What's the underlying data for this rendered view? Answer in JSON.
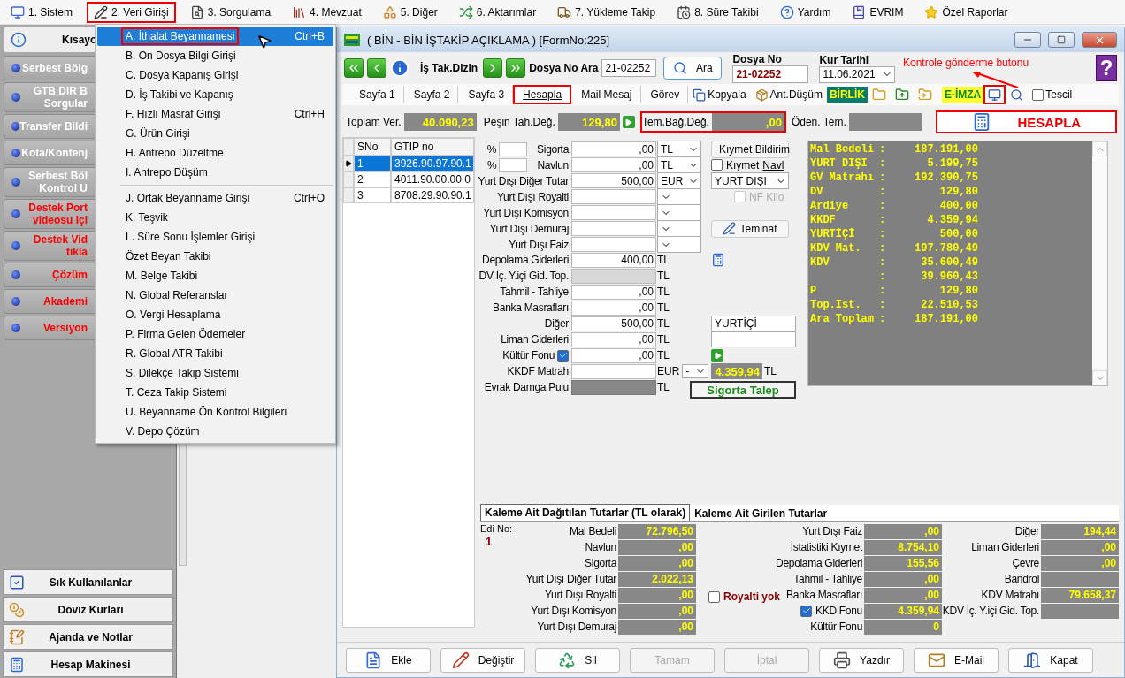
{
  "menubar": [
    {
      "label": "1. Sistem",
      "highlighted": false
    },
    {
      "label": "2. Veri Girişi",
      "highlighted": true
    },
    {
      "label": "3. Sorgulama",
      "highlighted": false
    },
    {
      "label": "4. Mevzuat",
      "highlighted": false
    },
    {
      "label": "5. Diğer",
      "highlighted": false
    },
    {
      "label": "6. Aktarımlar",
      "highlighted": false
    },
    {
      "label": "7. Yükleme Takip",
      "highlighted": false
    },
    {
      "label": "8. Süre Takibi",
      "highlighted": false
    },
    {
      "label": "Yardım",
      "highlighted": false
    },
    {
      "label": "EVRIM",
      "highlighted": false
    },
    {
      "label": "Özel Raporlar",
      "highlighted": false
    }
  ],
  "dropdown": {
    "groups": [
      {
        "items": [
          {
            "label": "A. İthalat Beyannamesi",
            "shortcut": "Ctrl+B",
            "selected": true,
            "highlighted": true
          },
          {
            "label": "B. Ön Dosya Bilgi Girişi",
            "selected": false,
            "highlighted": false
          },
          {
            "label": "C. Dosya Kapanış Girişi",
            "selected": false,
            "highlighted": false
          },
          {
            "label": "D. İş Takibi ve Kapanış",
            "selected": false,
            "highlighted": false
          },
          {
            "label": "F. Hızlı Masraf Girişi",
            "shortcut": "Ctrl+H",
            "selected": false,
            "highlighted": false
          },
          {
            "label": "G. Ürün Girişi",
            "selected": false,
            "highlighted": false
          },
          {
            "label": "H. Antrepo Düzeltme",
            "selected": false,
            "highlighted": false
          },
          {
            "label": "I. Antrepo Düşüm",
            "selected": false,
            "highlighted": false
          }
        ]
      },
      {
        "items": [
          {
            "label": "J. Ortak Beyanname Girişi",
            "shortcut": "Ctrl+O",
            "selected": false,
            "highlighted": false
          },
          {
            "label": "K. Teşvik",
            "selected": false,
            "highlighted": false
          },
          {
            "label": "L. Süre Sonu İşlemler Girişi",
            "selected": false,
            "highlighted": false
          },
          {
            "label": "Özet Beyan Takibi",
            "selected": false,
            "highlighted": false
          },
          {
            "label": "M. Belge Takibi",
            "selected": false,
            "highlighted": false
          },
          {
            "label": "N. Global Referanslar",
            "selected": false,
            "highlighted": false
          },
          {
            "label": "O. Vergi Hesaplama",
            "selected": false,
            "highlighted": false
          },
          {
            "label": "P. Firma Gelen Ödemeler",
            "selected": false,
            "highlighted": false
          },
          {
            "label": "R. Global ATR Takibi",
            "selected": false,
            "highlighted": false
          },
          {
            "label": "S. Dilekçe Takip Sistemi",
            "selected": false,
            "highlighted": false
          },
          {
            "label": "T. Ceza Takip Sistemi",
            "selected": false,
            "highlighted": false
          },
          {
            "label": "U. Beyanname Ön Kontrol Bilgileri",
            "selected": false,
            "highlighted": false
          },
          {
            "label": "V. Depo Çözüm",
            "selected": false,
            "highlighted": false
          }
        ]
      }
    ]
  },
  "sidebar": {
    "header": "Kısayo",
    "items": [
      {
        "lines": [
          "Serbest Bölg"
        ],
        "kind": "normal"
      },
      {
        "lines": [
          "GTB DIR B",
          "Sorgular"
        ],
        "kind": "normal"
      },
      {
        "lines": [
          "Transfer Bildi"
        ],
        "kind": "normal"
      },
      {
        "lines": [
          "Kota/Kontenj"
        ],
        "kind": "normal"
      },
      {
        "lines": [
          "Serbest Böl",
          "Kontrol U"
        ],
        "kind": "normal"
      },
      {
        "lines": [
          "Destek Port",
          "videosu içi"
        ],
        "kind": "support"
      },
      {
        "lines": [
          "Destek Vid",
          "tıkla"
        ],
        "kind": "support"
      },
      {
        "lines": [
          "Çözüm"
        ],
        "kind": "support"
      },
      {
        "lines": [
          "Akademi"
        ],
        "kind": "support"
      },
      {
        "lines": [
          "Versiyon"
        ],
        "kind": "support"
      }
    ],
    "bottom": [
      "Sık Kullanılanlar",
      "Doviz Kurları",
      "Ajanda ve Notlar",
      "Hesap Makinesi"
    ]
  },
  "window": {
    "title": "( BİN - BİN İŞTAKİP AÇIKLAMA ) [FormNo:225]"
  },
  "toolbar": {
    "dizin_label": "İş Tak.Dizin",
    "search_label": "Dosya No Ara",
    "search_value": "21-02252",
    "search_button": "Ara",
    "dosya_no_label": "Dosya No",
    "dosya_no": "21-02252",
    "kur_label": "Kur Tarihi",
    "kur_value": "11.06.2021",
    "help_glyph": "?",
    "annotation": "Kontrole gönderme butonu"
  },
  "tabs": [
    {
      "label": "Sayfa 1",
      "selected": false,
      "highlighted": false
    },
    {
      "label": "Sayfa 2",
      "selected": false,
      "highlighted": false
    },
    {
      "label": "Sayfa 3",
      "selected": false,
      "highlighted": false
    },
    {
      "label": "Hesapla",
      "selected": true,
      "highlighted": true
    },
    {
      "label": "Mail Mesaj",
      "selected": false,
      "highlighted": false
    },
    {
      "label": "Görev",
      "selected": false,
      "highlighted": false
    }
  ],
  "tools": [
    {
      "kind": "copy",
      "label": "Kopyala"
    },
    {
      "kind": "box",
      "label": "Ant.Düşüm"
    },
    {
      "kind": "badge",
      "label": "BİRLİK"
    },
    {
      "kind": "folder"
    },
    {
      "kind": "upload"
    },
    {
      "kind": "forward"
    },
    {
      "kind": "esign",
      "label": "E-İMZA"
    },
    {
      "kind": "monitor",
      "highlighted": true
    },
    {
      "kind": "search"
    },
    {
      "kind": "checkbox",
      "label": "Tescil",
      "checked": false
    }
  ],
  "totals": [
    {
      "label": "Toplam Ver.",
      "value": "40.090,23",
      "highlighted": false
    },
    {
      "label": "Peşin Tah.Değ.",
      "value": "129,80",
      "highlighted": false
    },
    {
      "label": "Tem.Bağ.Değ.",
      "value": ",00",
      "highlighted": true
    },
    {
      "label": "Öden. Tem.",
      "highlighted": false
    }
  ],
  "hesapla_button": "HESAPLA",
  "grid": {
    "columns": [
      "SNo",
      "GTIP no"
    ],
    "rows": [
      {
        "cells": [
          "1",
          "3926.90.97.90.1"
        ],
        "selected": true
      },
      {
        "cells": [
          "2",
          "4011.90.00.00.0"
        ],
        "selected": false
      },
      {
        "cells": [
          "3",
          "8708.29.90.90.1"
        ],
        "selected": false
      }
    ]
  },
  "form": [
    {
      "kind": "percent",
      "prefix": "%",
      "label": "Sigorta",
      "value": ",00",
      "currency": "TL",
      "side": {
        "kind": "report_button",
        "label": "Kıymet Bildirim"
      }
    },
    {
      "kind": "percent",
      "prefix": "%",
      "label": "Navlun",
      "value": ",00",
      "currency": "TL",
      "side": {
        "kind": "check_link",
        "label": "Kıymet",
        "link": "Navl",
        "checked": false
      }
    },
    {
      "kind": "select",
      "label": "Yurt Dışı Diğer Tutar",
      "value": "500,00",
      "currency": "EUR",
      "side": {
        "kind": "select",
        "value": "YURT DIŞI"
      }
    },
    {
      "kind": "select",
      "label": "Yurt Dışı Royalti",
      "side": {
        "kind": "disabled_check",
        "label": "NF Kilo",
        "checked": false
      }
    },
    {
      "kind": "select",
      "label": "Yurt Dışı Komisyon"
    },
    {
      "kind": "select",
      "label": "Yurt Dışı Demuraj",
      "side": {
        "kind": "sign_button",
        "label": "Teminat"
      }
    },
    {
      "kind": "select",
      "label": "Yurt Dışı Faiz"
    },
    {
      "kind": "plain",
      "label": "Depolama Giderleri",
      "value": "400,00",
      "currency": "TL",
      "side": {
        "kind": "calculator"
      }
    },
    {
      "kind": "gray",
      "label": "DV İç. Y.içi Gid. Top.",
      "currency": "TL"
    },
    {
      "kind": "plain",
      "label": "Tahmil - Tahliye",
      "value": ",00",
      "currency": "TL"
    },
    {
      "kind": "plain",
      "label": "Banka Masrafları",
      "value": ",00",
      "currency": "TL"
    },
    {
      "kind": "plain",
      "label": "Diğer",
      "value": "500,00",
      "currency": "TL",
      "side": {
        "kind": "field",
        "value": "YURTİÇİ"
      }
    },
    {
      "kind": "plain",
      "label": "Liman Giderleri",
      "value": ",00",
      "currency": "TL",
      "side": {
        "kind": "field"
      }
    },
    {
      "kind": "check",
      "label": "Kültür Fonu",
      "checked": true,
      "value": ",00",
      "currency": "TL",
      "side": {
        "kind": "go"
      }
    },
    {
      "kind": "kkdf",
      "label": "KKDF Matrah",
      "currency": "EUR",
      "option": "-",
      "side": {
        "kind": "result",
        "value": "4.359,94",
        "unit": "TL"
      }
    },
    {
      "kind": "gray",
      "label": "Evrak Damga Pulu",
      "currency": "TL",
      "side": {
        "kind": "talep_button",
        "label": "Sigorta Talep"
      }
    }
  ],
  "summary": [
    {
      "label": "Mal Bedeli",
      "colon": ":",
      "value": "187.191,00"
    },
    {
      "label": "YURT DIŞI",
      "colon": ":",
      "value": "5.199,75"
    },
    {
      "label": "GV Matrahı",
      "colon": ":",
      "value": "192.390,75"
    },
    {
      "label": "DV",
      "colon": ":",
      "value": "129,80"
    },
    {
      "label": "Ardiye",
      "colon": ":",
      "value": "400,00"
    },
    {
      "label": "KKDF",
      "colon": ":",
      "value": "4.359,94"
    },
    {
      "label": "YURTİÇİ",
      "colon": ":",
      "value": "500,00"
    },
    {
      "label": "KDV Mat.",
      "colon": ":",
      "value": "197.780,49"
    },
    {
      "label": "KDV",
      "colon": ":",
      "value": "35.600,49"
    },
    {
      "colon": ":",
      "value": "39.960,43"
    },
    {
      "label": "P",
      "colon": ":",
      "value": "129,80"
    },
    {
      "label": "Top.Ist.",
      "colon": ":",
      "value": "22.510,53"
    },
    {
      "label": "Ara Toplam",
      "colon": ":",
      "value": "187.191,00"
    }
  ],
  "bottom_tabs": [
    {
      "label": "Kaleme Ait Dağıtılan Tutarlar (TL olarak)",
      "selected": true
    },
    {
      "label": "Kaleme Ait Girilen Tutarlar",
      "selected": false
    }
  ],
  "bottom": {
    "edi_label": "Edi No:",
    "edi_value": "1",
    "royalti": {
      "label": "Royalti yok",
      "checked": false
    },
    "columns": [
      {
        "rows": [
          {
            "kind": "plain",
            "label": "Mal Bedeli",
            "value": "72.796,50"
          },
          {
            "kind": "plain",
            "label": "Navlun",
            "value": ",00"
          },
          {
            "kind": "plain",
            "label": "Sigorta",
            "value": ",00"
          },
          {
            "kind": "plain",
            "label": "Yurt Dışı Diğer Tutar",
            "value": "2.022,13"
          },
          {
            "kind": "plain",
            "label": "Yurt Dışı Royalti",
            "value": ",00"
          },
          {
            "kind": "plain",
            "label": "Yurt Dışı Komisyon",
            "value": ",00"
          },
          {
            "kind": "plain",
            "label": "Yurt Dışı Demuraj",
            "value": ",00"
          }
        ]
      },
      {
        "rows": [
          {
            "kind": "plain",
            "label": "Yurt Dışı Faiz",
            "value": ",00"
          },
          {
            "kind": "plain",
            "label": "İstatistiki Kıymet",
            "value": "8.754,10"
          },
          {
            "kind": "plain",
            "label": "Depolama Giderleri",
            "value": "155,56"
          },
          {
            "kind": "plain",
            "label": "Tahmil - Tahliye",
            "value": ",00"
          },
          {
            "kind": "plain",
            "label": "Banka Masrafları",
            "value": ",00"
          },
          {
            "kind": "check",
            "label": "KKD Fonu",
            "checked": true,
            "value": "4.359,94"
          },
          {
            "kind": "plain",
            "label": "Kültür Fonu",
            "value": "0"
          }
        ]
      },
      {
        "rows": [
          {
            "kind": "plain",
            "label": "Diğer",
            "value": "194,44"
          },
          {
            "kind": "plain",
            "label": "Liman Giderleri",
            "value": ",00"
          },
          {
            "kind": "plain",
            "label": "Çevre",
            "value": ",00"
          },
          {
            "kind": "plain",
            "label": "Bandrol"
          },
          {
            "kind": "plain",
            "label": "KDV Matrahı",
            "value": "79.658,37"
          },
          {
            "kind": "plain",
            "label": "KDV İç. Y.içi Gid. Top."
          }
        ]
      }
    ]
  },
  "buttons": [
    {
      "label": "Ekle",
      "disabled": false
    },
    {
      "label": "Değiştir",
      "disabled": false
    },
    {
      "label": "Sil",
      "disabled": false
    },
    {
      "label": "Tamam",
      "disabled": true
    },
    {
      "label": "İptal",
      "disabled": true
    },
    {
      "label": "Yazdır",
      "disabled": false
    },
    {
      "label": "E-Mail",
      "disabled": false
    },
    {
      "label": "Kapat",
      "disabled": false
    }
  ]
}
